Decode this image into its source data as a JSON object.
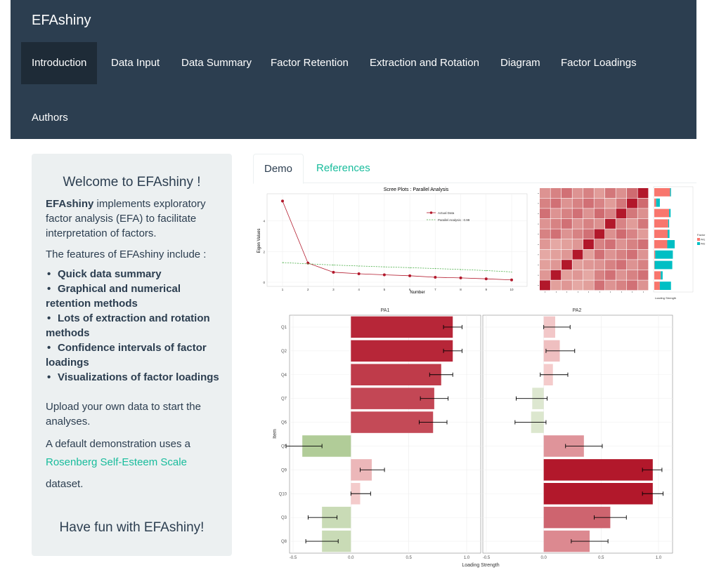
{
  "brand": "EFAshiny",
  "nav": [
    {
      "label": "Introduction",
      "active": true
    },
    {
      "label": "Data Input"
    },
    {
      "label": "Data Summary"
    },
    {
      "label": "Factor Retention"
    },
    {
      "label": "Extraction and Rotation"
    },
    {
      "label": "Diagram"
    },
    {
      "label": "Factor Loadings"
    },
    {
      "label": "Authors"
    }
  ],
  "sidebar": {
    "title": "Welcome to EFAshiny !",
    "intro_bold": "EFAshiny",
    "intro_rest": " implements exploratory factor analysis (EFA) to facilitate interpretation of factors.",
    "features_intro": "The features of EFAshiny include :",
    "features": [
      "Quick data summary",
      "Graphical and numerical retention methods",
      "Lots of extraction and rotation methods",
      "Confidence intervals of factor loadings",
      "Visualizations of factor loadings"
    ],
    "upload_text": "Upload your own data to start the analyses.",
    "demo_text": "A default demonstration uses a",
    "demo_link": "Rosenberg Self-Esteem Scale",
    "demo_after": "dataset.",
    "fun": "Have fun with EFAshiny!"
  },
  "tabs": [
    {
      "label": "Demo",
      "active": true
    },
    {
      "label": "References"
    }
  ],
  "colors": {
    "navbar": "#2c3e50",
    "accent": "#18bc9c",
    "sidebar_bg": "#ecf0f1",
    "bar_dark": "#b2182b",
    "bar_green": "#a6c58a"
  },
  "chart_data": [
    {
      "type": "line",
      "title": "Scree Plots : Parallel Analysis",
      "xlabel": "Number",
      "ylabel": "Eigen Values",
      "x": [
        1,
        2,
        3,
        4,
        5,
        6,
        7,
        8,
        9,
        10
      ],
      "xlim": [
        1,
        10
      ],
      "ylim": [
        0,
        5.5
      ],
      "yticks": [
        0,
        2,
        4
      ],
      "series": [
        {
          "name": "Actual Data",
          "values": [
            5.3,
            1.25,
            0.65,
            0.55,
            0.48,
            0.42,
            0.32,
            0.28,
            0.22,
            0.15
          ],
          "color": "#b2182b"
        },
        {
          "name": "Parallel Analysis : 0.99",
          "values": [
            1.28,
            1.2,
            1.12,
            1.06,
            1.0,
            0.95,
            0.89,
            0.83,
            0.76,
            0.67
          ],
          "color": "#4daf4a"
        }
      ]
    },
    {
      "type": "heatmap",
      "rows": 10,
      "cols": 10
    },
    {
      "type": "bar",
      "panel": "mini-loadings",
      "xlabel": "Loading Strength",
      "legend_title": "Factor",
      "series": [
        {
          "name": "PA1",
          "values": [
            0.85,
            0.1,
            0.8,
            0.75,
            0.72,
            0.7,
            0.05,
            0.02,
            0.35,
            0.3
          ],
          "color": "#f8766d"
        },
        {
          "name": "PA2",
          "values": [
            0.05,
            0.2,
            0.08,
            0.05,
            0.1,
            0.4,
            0.95,
            0.95,
            0.1,
            0.6
          ],
          "color": "#00bfc4"
        }
      ]
    },
    {
      "type": "bar",
      "orientation": "horizontal",
      "panels": [
        "PA1",
        "PA2"
      ],
      "categories": [
        "Q1",
        "Q2",
        "Q4",
        "Q7",
        "Q6",
        "Q5",
        "Q9",
        "Q10",
        "Q3",
        "Q8"
      ],
      "xlabel": "Loading Strength",
      "ylabel": "Item",
      "xlim": [
        -0.5,
        1.0
      ],
      "xticks": [
        -0.5,
        0.0,
        0.5,
        1.0
      ],
      "series": [
        {
          "name": "PA1",
          "values": [
            0.88,
            0.88,
            0.78,
            0.72,
            0.71,
            -0.42,
            0.18,
            0.08,
            -0.25,
            -0.25
          ],
          "ci_low": [
            0.8,
            0.8,
            0.68,
            0.6,
            0.59,
            -0.56,
            0.08,
            0.0,
            -0.37,
            -0.39
          ],
          "ci_high": [
            0.96,
            0.96,
            0.88,
            0.84,
            0.83,
            -0.25,
            0.29,
            0.17,
            -0.12,
            -0.11
          ]
        },
        {
          "name": "PA2",
          "values": [
            0.1,
            0.14,
            0.08,
            -0.1,
            -0.11,
            0.35,
            0.95,
            0.95,
            0.58,
            0.4
          ],
          "ci_low": [
            0.0,
            0.02,
            -0.03,
            -0.24,
            -0.25,
            0.19,
            0.86,
            0.86,
            0.44,
            0.24
          ],
          "ci_high": [
            0.23,
            0.27,
            0.21,
            0.03,
            0.02,
            0.51,
            1.03,
            1.04,
            0.72,
            0.56
          ]
        }
      ]
    }
  ]
}
